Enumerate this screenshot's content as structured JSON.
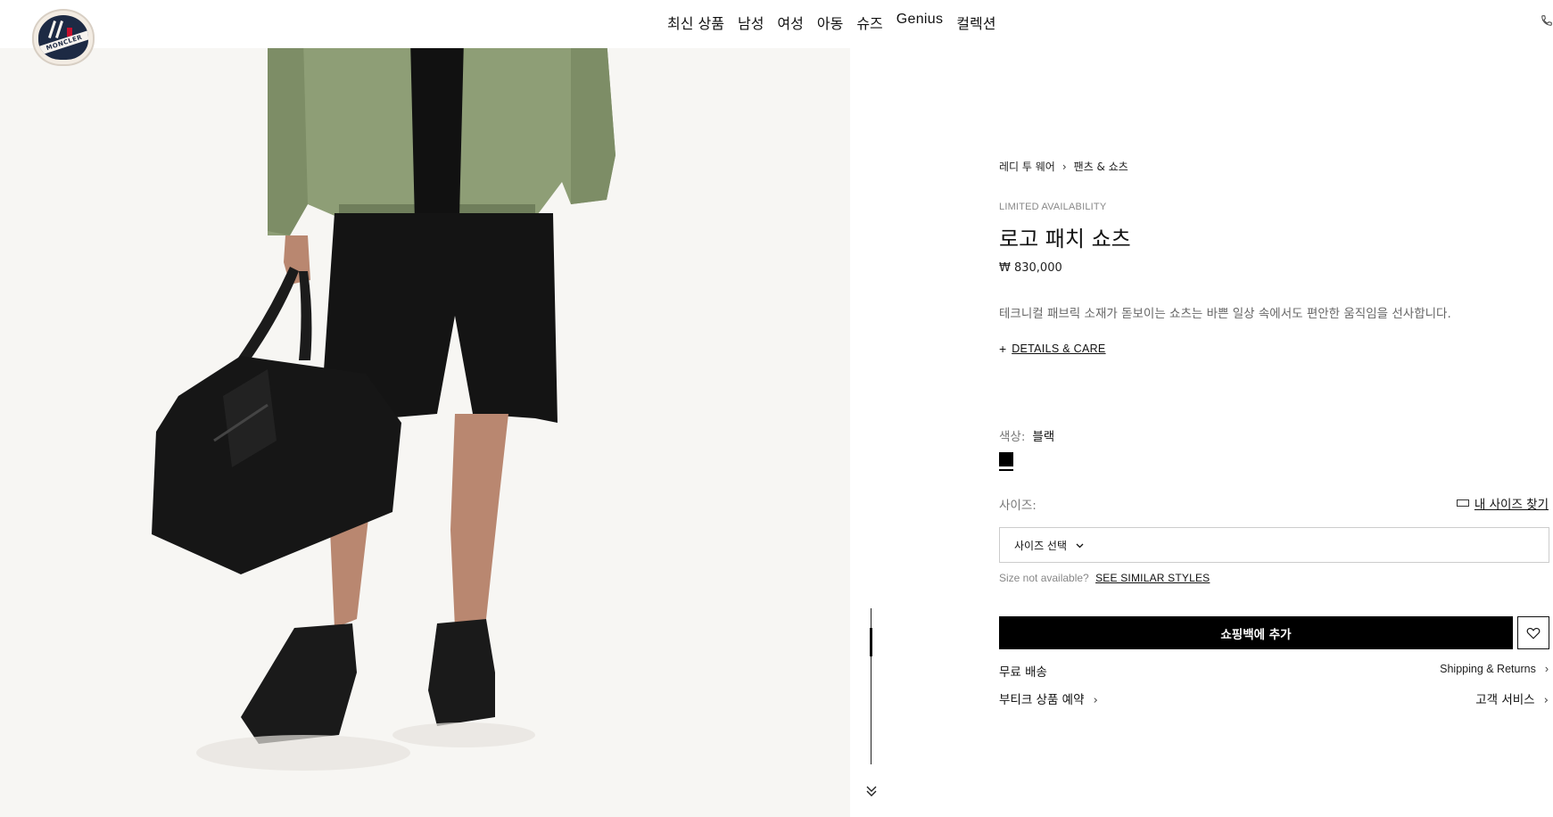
{
  "header": {
    "logo_text": "MONCLER",
    "nav": [
      "최신 상품",
      "남성",
      "여성",
      "아동",
      "슈즈",
      "Genius",
      "컬렉션"
    ]
  },
  "icons": {
    "phone": "phone-icon",
    "scroll_down": "double-chevron-down-icon",
    "wishlist": "heart-icon",
    "size_guide": "ruler-icon"
  },
  "breadcrumb": [
    "레디 투 웨어",
    "팬츠 & 쇼츠"
  ],
  "product": {
    "availability": "LIMITED AVAILABILITY",
    "title": "로고 패치 쇼츠",
    "price": "₩ 830,000",
    "description": "테크니컬 패브릭 소재가 돋보이는 쇼츠는 바쁜 일상 속에서도 편안한 움직임을 선사합니다.",
    "details_plus": "+",
    "details_label": "DETAILS & CARE"
  },
  "color": {
    "label": "색상:",
    "value": "블랙",
    "swatch_hex": "#000000"
  },
  "size": {
    "label": "사이즈:",
    "guide_label": "내 사이즈 찾기",
    "select_placeholder": "사이즈 선택",
    "not_available": "Size not available?",
    "similar_link": "SEE SIMILAR STYLES"
  },
  "actions": {
    "add_to_bag": "쇼핑백에 추가",
    "free_shipping": "무료 배송",
    "shipping_returns": "Shipping & Returns",
    "boutique_reserve": "부티크 상품 예약",
    "customer_service": "고객 서비스"
  },
  "colors": {
    "accent": "#000000",
    "image_bg": "#f7f6f3"
  }
}
